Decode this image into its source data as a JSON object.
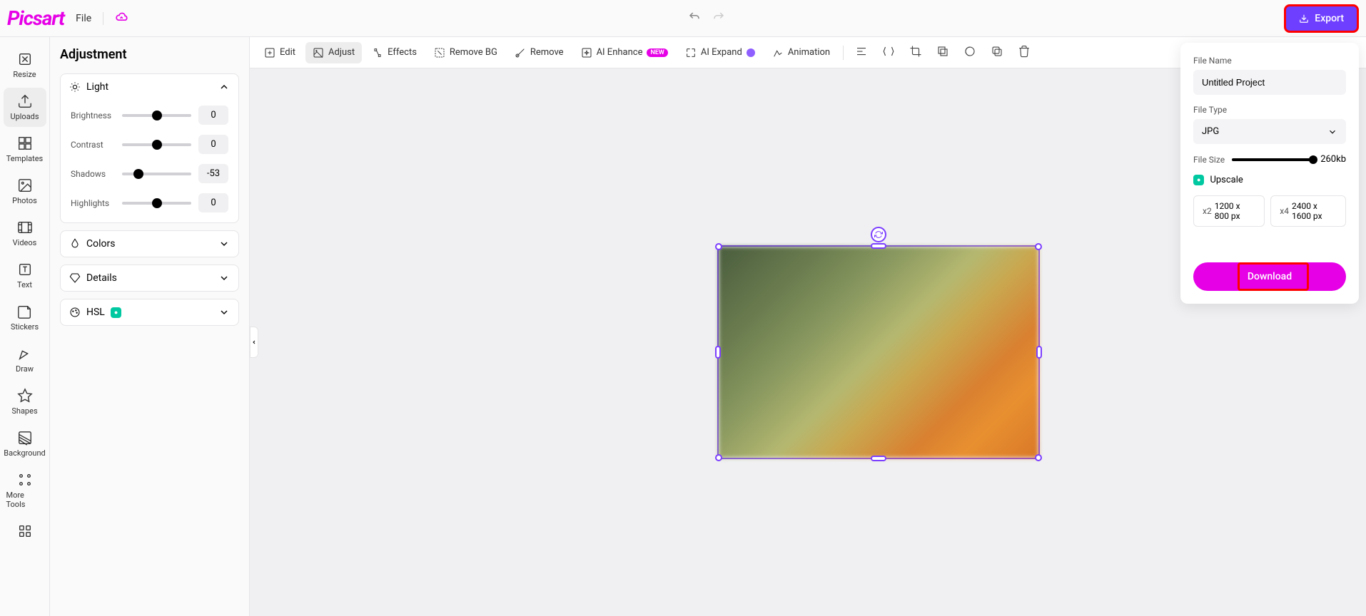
{
  "brand": "Picsart",
  "topbar": {
    "file_menu": "File",
    "export_label": "Export"
  },
  "left_rail": [
    {
      "id": "resize",
      "label": "Resize"
    },
    {
      "id": "uploads",
      "label": "Uploads"
    },
    {
      "id": "templates",
      "label": "Templates"
    },
    {
      "id": "photos",
      "label": "Photos"
    },
    {
      "id": "videos",
      "label": "Videos"
    },
    {
      "id": "text",
      "label": "Text"
    },
    {
      "id": "stickers",
      "label": "Stickers"
    },
    {
      "id": "draw",
      "label": "Draw"
    },
    {
      "id": "shapes",
      "label": "Shapes"
    },
    {
      "id": "background",
      "label": "Background"
    },
    {
      "id": "more_tools",
      "label": "More Tools"
    }
  ],
  "side_panel": {
    "title": "Adjustment",
    "sections": {
      "light": {
        "label": "Light",
        "sliders": [
          {
            "id": "brightness",
            "label": "Brightness",
            "value": "0",
            "pos": 50
          },
          {
            "id": "contrast",
            "label": "Contrast",
            "value": "0",
            "pos": 50
          },
          {
            "id": "shadows",
            "label": "Shadows",
            "value": "-53",
            "pos": 24
          },
          {
            "id": "highlights",
            "label": "Highlights",
            "value": "0",
            "pos": 50
          }
        ]
      },
      "colors": {
        "label": "Colors"
      },
      "details": {
        "label": "Details"
      },
      "hsl": {
        "label": "HSL",
        "pro": true
      }
    }
  },
  "action_bar": [
    {
      "id": "edit",
      "label": "Edit"
    },
    {
      "id": "adjust",
      "label": "Adjust"
    },
    {
      "id": "effects",
      "label": "Effects"
    },
    {
      "id": "remove_bg",
      "label": "Remove BG"
    },
    {
      "id": "remove",
      "label": "Remove"
    },
    {
      "id": "ai_enhance",
      "label": "AI Enhance",
      "badge_new": "NEW"
    },
    {
      "id": "ai_expand",
      "label": "AI Expand",
      "badge_ai": true
    },
    {
      "id": "animation",
      "label": "Animation"
    }
  ],
  "export_panel": {
    "file_name_label": "File Name",
    "file_name_value": "Untitled Project",
    "file_type_label": "File Type",
    "file_type_value": "JPG",
    "file_size_label": "File Size",
    "file_size_value": "260kb",
    "upscale_label": "Upscale",
    "upscale_options": [
      {
        "mult": "x2",
        "dims": "1200 x 800 px"
      },
      {
        "mult": "x4",
        "dims": "2400 x 1600 px"
      }
    ],
    "download_label": "Download"
  }
}
